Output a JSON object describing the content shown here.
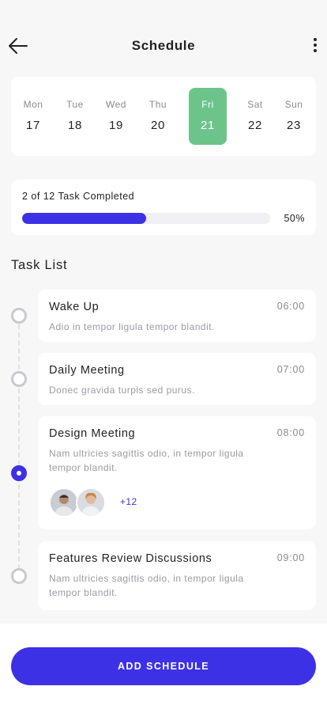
{
  "header": {
    "title": "Schedule",
    "back_icon": "arrow-left-icon",
    "more_icon": "more-vertical-icon"
  },
  "week": {
    "days": [
      {
        "name": "Mon",
        "num": "17"
      },
      {
        "name": "Tue",
        "num": "18"
      },
      {
        "name": "Wed",
        "num": "19"
      },
      {
        "name": "Thu",
        "num": "20"
      },
      {
        "name": "Fri",
        "num": "21"
      },
      {
        "name": "Sat",
        "num": "22"
      },
      {
        "name": "Sun",
        "num": "23"
      }
    ],
    "selected_day": "Fri",
    "selected_color": "#6cc48b"
  },
  "progress": {
    "label": "2 of 12 Task Completed",
    "percent_text": "50%",
    "fraction": 0.5,
    "bar_color": "#3d31e6"
  },
  "task_list": {
    "title": "Task List",
    "tasks": [
      {
        "title": "Wake Up",
        "time": "06:00",
        "description": "Adio in tempor ligula tempor blandit."
      },
      {
        "title": "Daily Meeting",
        "time": "07:00",
        "description": "Donec gravida turpis sed purus."
      },
      {
        "title": "Design Meeting",
        "time": "08:00",
        "description": "Nam ultricies sagittis odio, in tempor ligula tempor blandit.",
        "extra_attendees": "+12"
      },
      {
        "title": "Features Review Discussions",
        "time": "09:00",
        "description": "Nam ultricies sagittis odio, in tempor ligula tempor blandit."
      }
    ]
  },
  "footer": {
    "add_button": "ADD SCHEDULE"
  },
  "colors": {
    "accent": "#3d31e6",
    "background": "#f7f7f8"
  }
}
